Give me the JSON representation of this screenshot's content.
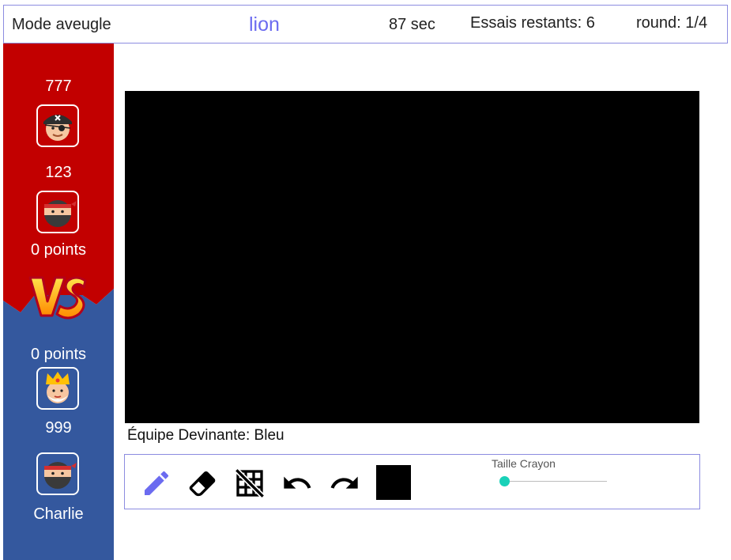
{
  "header": {
    "mode": "Mode aveugle",
    "word": "lion",
    "timer": "87 sec",
    "tries": "Essais restants: 6",
    "round": "round: 1/4"
  },
  "red_team": {
    "color": "#c20000",
    "points": "0 points",
    "players": [
      {
        "name": "777",
        "avatar": "pirate-avatar-icon"
      },
      {
        "name": "123",
        "avatar": "ninja-avatar-icon"
      }
    ]
  },
  "blue_team": {
    "color": "#34589e",
    "points": "0 points",
    "players": [
      {
        "name": "999",
        "avatar": "king-avatar-icon"
      },
      {
        "name": "Charlie",
        "avatar": "ninja-avatar-icon"
      }
    ]
  },
  "canvas": {
    "background": "#000000",
    "team_label": "Équipe Devinante: Bleu"
  },
  "toolbar": {
    "tools": [
      "pencil-icon",
      "eraser-icon",
      "grid-off-icon",
      "undo-icon",
      "redo-icon"
    ],
    "current_color": "#000000",
    "brush_size_label": "Taille Crayon",
    "brush_size_fraction": 0,
    "accent_color": "#6b6bf0",
    "slider_color": "#19d1b8"
  }
}
